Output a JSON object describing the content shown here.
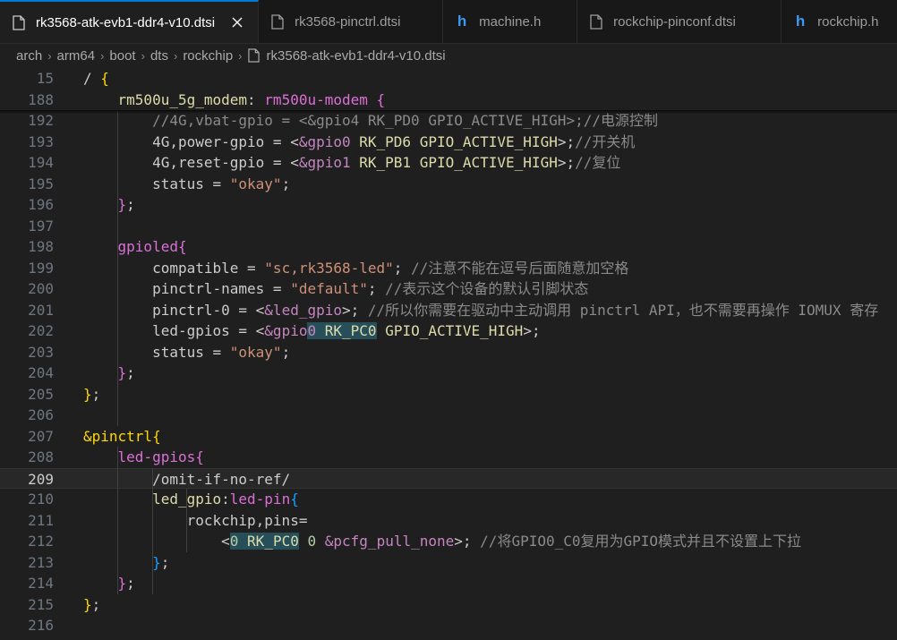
{
  "tabs": [
    {
      "label": "rk3568-atk-evb1-ddr4-v10.dtsi",
      "icon": "file-icon",
      "active": true
    },
    {
      "label": "rk3568-pinctrl.dtsi",
      "icon": "file-icon",
      "active": false
    },
    {
      "label": "machine.h",
      "icon": "h-file-icon",
      "active": false
    },
    {
      "label": "rockchip-pinconf.dtsi",
      "icon": "file-icon",
      "active": false
    },
    {
      "label": "rockchip.h",
      "icon": "h-file-icon",
      "active": false
    }
  ],
  "breadcrumb": [
    "arch",
    "arm64",
    "boot",
    "dts",
    "rockchip",
    "rk3568-atk-evb1-ddr4-v10.dtsi"
  ],
  "editor": {
    "current_line": "209",
    "lines": [
      {
        "n": "15",
        "text": "/ {"
      },
      {
        "n": "188",
        "text": "    rm500u_5g_modem: rm500u-modem {"
      },
      {
        "n": "192",
        "text": "        //4G,vbat-gpio = <&gpio4 RK_PD0 GPIO_ACTIVE_HIGH>;//电源控制"
      },
      {
        "n": "193",
        "text": "        4G,power-gpio = <&gpio0 RK_PD6 GPIO_ACTIVE_HIGH>;//开关机"
      },
      {
        "n": "194",
        "text": "        4G,reset-gpio = <&gpio1 RK_PB1 GPIO_ACTIVE_HIGH>;//复位"
      },
      {
        "n": "195",
        "text": "        status = \"okay\";"
      },
      {
        "n": "196",
        "text": "    };"
      },
      {
        "n": "197",
        "text": ""
      },
      {
        "n": "198",
        "text": "    gpioled{"
      },
      {
        "n": "199",
        "text": "        compatible = \"sc,rk3568-led\"; //注意不能在逗号后面随意加空格"
      },
      {
        "n": "200",
        "text": "        pinctrl-names = \"default\"; //表示这个设备的默认引脚状态"
      },
      {
        "n": "201",
        "text": "        pinctrl-0 = <&led_gpio>; //所以你需要在驱动中主动调用 pinctrl API，也不需要再操作 IOMUX 寄存"
      },
      {
        "n": "202",
        "text": "        led-gpios = <&gpio0 RK_PC0 GPIO_ACTIVE_HIGH>;"
      },
      {
        "n": "203",
        "text": "        status = \"okay\";"
      },
      {
        "n": "204",
        "text": "    };"
      },
      {
        "n": "205",
        "text": "};"
      },
      {
        "n": "206",
        "text": ""
      },
      {
        "n": "207",
        "text": "&pinctrl{"
      },
      {
        "n": "208",
        "text": "    led-gpios{"
      },
      {
        "n": "209",
        "text": "        /omit-if-no-ref/"
      },
      {
        "n": "210",
        "text": "        led_gpio:led-pin{"
      },
      {
        "n": "211",
        "text": "            rockchip,pins="
      },
      {
        "n": "212",
        "text": "                <0 RK_PC0 0 &pcfg_pull_none>; //将GPIO0_C0复用为GPIO模式并且不设置上下拉"
      },
      {
        "n": "213",
        "text": "        };"
      },
      {
        "n": "214",
        "text": "    };"
      },
      {
        "n": "215",
        "text": "};"
      },
      {
        "n": "216",
        "text": ""
      }
    ]
  },
  "colors": {
    "accent": "#0078d4",
    "background": "#1f1f1f",
    "tabbar": "#181818"
  }
}
